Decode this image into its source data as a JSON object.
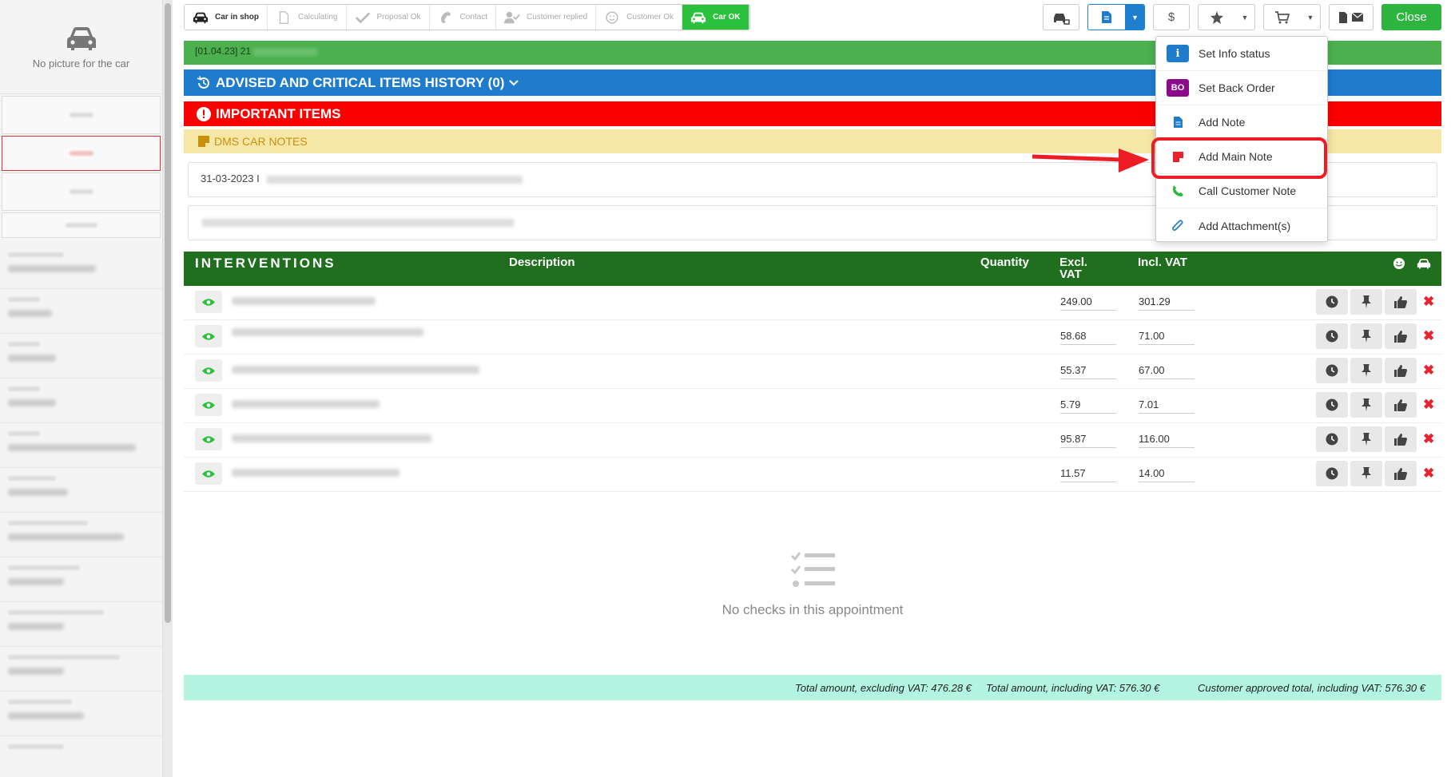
{
  "sidebar": {
    "no_picture_label": "No picture for the car"
  },
  "steps": [
    {
      "label": "Car in shop",
      "icon": "car-icon",
      "state": "dark"
    },
    {
      "label": "Calculating",
      "icon": "document-icon",
      "state": "muted"
    },
    {
      "label": "Proposal Ok",
      "icon": "check-icon",
      "state": "muted"
    },
    {
      "label": "Contact",
      "icon": "phone-icon",
      "state": "muted"
    },
    {
      "label": "Customer replied",
      "icon": "user-check-icon",
      "state": "muted"
    },
    {
      "label": "Customer Ok",
      "icon": "smiley-icon",
      "state": "muted"
    },
    {
      "label": "Car OK",
      "icon": "car-icon",
      "state": "active"
    }
  ],
  "toolbar": {
    "dollar_label": "$",
    "close_label": "Close"
  },
  "banners": {
    "green_text": "[01.04.23] 21",
    "advised_title": "ADVISED AND CRITICAL ITEMS HISTORY (0)",
    "important_title": "IMPORTANT ITEMS",
    "dms_title": "DMS CAR NOTES",
    "note_date": "31-03-2023 I"
  },
  "interventions": {
    "title": "INTERVENTIONS",
    "col_description": "Description",
    "col_quantity": "Quantity",
    "col_excl_vat": "Excl.\nVAT",
    "col_incl_vat": "Incl. VAT",
    "rows": [
      {
        "excl": "249.00",
        "incl": "301.29"
      },
      {
        "excl": "58.68",
        "incl": "71.00"
      },
      {
        "excl": "55.37",
        "incl": "67.00"
      },
      {
        "excl": "5.79",
        "incl": "7.01"
      },
      {
        "excl": "95.87",
        "incl": "116.00"
      },
      {
        "excl": "11.57",
        "incl": "14.00"
      }
    ]
  },
  "empty_checks": "No checks in this appointment",
  "totals": {
    "excl": "Total amount, excluding VAT: 476.28 €",
    "incl": "Total amount, including VAT: 576.30 €",
    "approved": "Customer approved total, including VAT: 576.30 €"
  },
  "dropdown": {
    "items": [
      {
        "label": "Set Info status",
        "icon": "info-icon",
        "badge": "i",
        "color": "#1f7ccd"
      },
      {
        "label": "Set Back Order",
        "icon": "back-order-icon",
        "badge": "BO",
        "color": "#8b0a8b"
      },
      {
        "label": "Add Note",
        "icon": "note-icon",
        "badge": "",
        "color": "#1f7ccd"
      },
      {
        "label": "Add Main Note",
        "icon": "main-note-icon",
        "badge": "",
        "color": "#e8222e"
      },
      {
        "label": "Call Customer Note",
        "icon": "phone-icon",
        "badge": "",
        "color": "#2db53f"
      },
      {
        "label": "Add Attachment(s)",
        "icon": "paperclip-icon",
        "badge": "",
        "color": "#1f7ccd"
      }
    ]
  }
}
